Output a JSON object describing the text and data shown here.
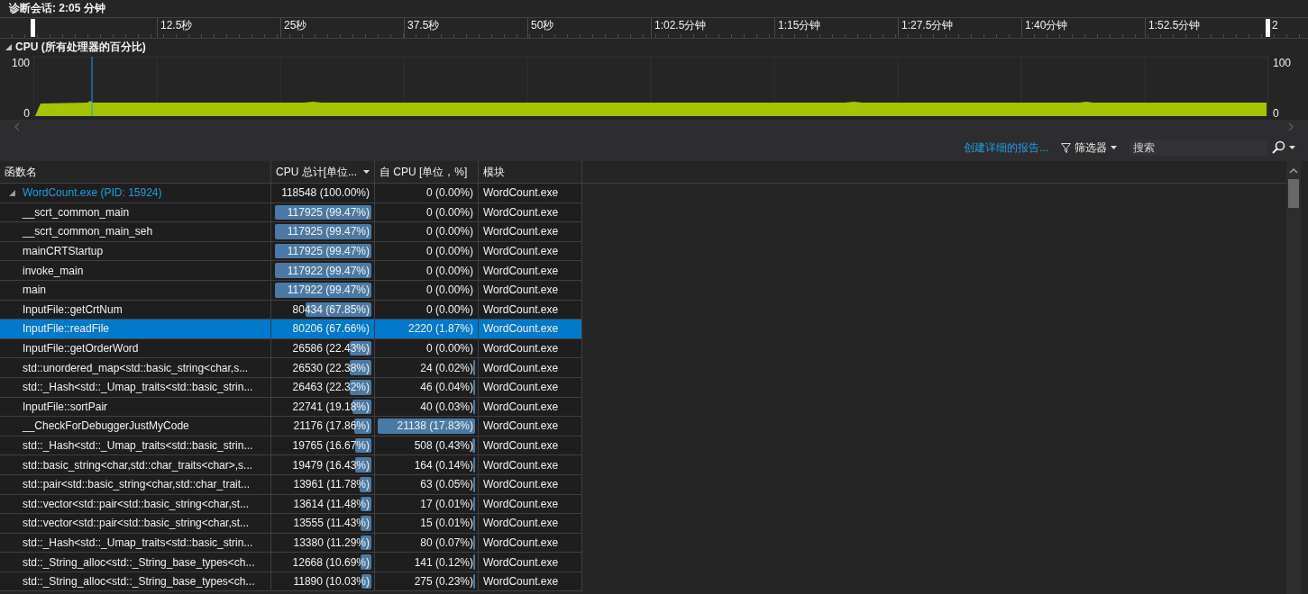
{
  "session": {
    "title": "诊断会话: 2:05 分钟"
  },
  "timeline": {
    "labels": [
      "12.5秒",
      "25秒",
      "37.5秒",
      "50秒",
      "1:02.5分钟",
      "1:15分钟",
      "1:27.5分钟",
      "1:40分钟",
      "1:52.5分钟",
      "2"
    ]
  },
  "cpu_panel": {
    "expanded": true,
    "title": "CPU (所有处理器的百分比)",
    "left_axis": [
      "100",
      "0"
    ],
    "right_axis": [
      "100",
      "0"
    ]
  },
  "toolbar": {
    "report_link": "创建详细的报告...",
    "filter": "筛选器",
    "search": {
      "placeholder": "搜索"
    }
  },
  "table": {
    "columns": [
      {
        "label": "函数名",
        "sorted": false
      },
      {
        "label": "CPU 总计[单位...",
        "sorted": true
      },
      {
        "label": "自 CPU [单位，%]",
        "sorted": false
      },
      {
        "label": "模块",
        "sorted": false
      }
    ],
    "rows": [
      {
        "name": "WordCount.exe (PID: 15924)",
        "expanded": true,
        "selected": false,
        "total": {
          "text": "118548 (100.00%)"
        },
        "self": {
          "text": "0 (0.00%)"
        },
        "module": "WordCount.exe",
        "children": [
          {
            "name": "__scrt_common_main",
            "selected": false,
            "total": {
              "text": "117925 (99.47%)",
              "level": 0.9947
            },
            "self": {
              "text": "0 (0.00%)"
            },
            "module": "WordCount.exe"
          },
          {
            "name": "__scrt_common_main_seh",
            "selected": false,
            "total": {
              "text": "117925 (99.47%)",
              "level": 0.9947
            },
            "self": {
              "text": "0 (0.00%)"
            },
            "module": "WordCount.exe"
          },
          {
            "name": "mainCRTStartup",
            "selected": false,
            "total": {
              "text": "117925 (99.47%)",
              "level": 0.9947
            },
            "self": {
              "text": "0 (0.00%)"
            },
            "module": "WordCount.exe"
          },
          {
            "name": "invoke_main",
            "selected": false,
            "total": {
              "text": "117922 (99.47%)",
              "level": 0.9947
            },
            "self": {
              "text": "0 (0.00%)"
            },
            "module": "WordCount.exe"
          },
          {
            "name": "main",
            "selected": false,
            "total": {
              "text": "117922 (99.47%)",
              "level": 0.9947
            },
            "self": {
              "text": "0 (0.00%)"
            },
            "module": "WordCount.exe"
          },
          {
            "name": "InputFile::getCrtNum",
            "selected": false,
            "total": {
              "text": "80434 (67.85%)",
              "level": 0.6785
            },
            "self": {
              "text": "0 (0.00%)"
            },
            "module": "WordCount.exe"
          },
          {
            "name": "InputFile::readFile",
            "selected": true,
            "total": {
              "text": "80206 (67.66%)"
            },
            "self": {
              "text": "2220 (1.87%)"
            },
            "module": "WordCount.exe"
          },
          {
            "name": "InputFile::getOrderWord",
            "selected": false,
            "total": {
              "text": "26586 (22.43%)",
              "level": 0.2243
            },
            "self": {
              "text": "0 (0.00%)"
            },
            "module": "WordCount.exe"
          },
          {
            "name": "std::unordered_map<std::basic_string<char,s...",
            "selected": false,
            "total": {
              "text": "26530 (22.38%)",
              "level": 0.2238
            },
            "self": {
              "text": "24 (0.02%)",
              "level": 0.0011
            },
            "module": "WordCount.exe"
          },
          {
            "name": "std::_Hash<std::_Umap_traits<std::basic_strin...",
            "selected": false,
            "total": {
              "text": "26463 (22.32%)",
              "level": 0.2232
            },
            "self": {
              "text": "46 (0.04%)",
              "level": 0.0022
            },
            "module": "WordCount.exe"
          },
          {
            "name": "InputFile::sortPair",
            "selected": false,
            "total": {
              "text": "22741 (19.18%)",
              "level": 0.1918
            },
            "self": {
              "text": "40 (0.03%)",
              "level": 0.0019
            },
            "module": "WordCount.exe"
          },
          {
            "name": "__CheckForDebuggerJustMyCode",
            "selected": false,
            "total": {
              "text": "21176 (17.86%)",
              "level": 0.1786
            },
            "self": {
              "text": "21138 (17.83%)",
              "level": 1
            },
            "module": "WordCount.exe"
          },
          {
            "name": "std::_Hash<std::_Umap_traits<std::basic_strin...",
            "selected": false,
            "total": {
              "text": "19765 (16.67%)",
              "level": 0.1667
            },
            "self": {
              "text": "508 (0.43%)",
              "level": 0.024
            },
            "module": "WordCount.exe"
          },
          {
            "name": "std::basic_string<char,std::char_traits<char>,s...",
            "selected": false,
            "total": {
              "text": "19479 (16.43%)",
              "level": 0.1643
            },
            "self": {
              "text": "164 (0.14%)",
              "level": 0.0078
            },
            "module": "WordCount.exe"
          },
          {
            "name": "std::pair<std::basic_string<char,std::char_trait...",
            "selected": false,
            "total": {
              "text": "13961 (11.78%)",
              "level": 0.1178
            },
            "self": {
              "text": "63 (0.05%)",
              "level": 0.003
            },
            "module": "WordCount.exe"
          },
          {
            "name": "std::vector<std::pair<std::basic_string<char,st...",
            "selected": false,
            "total": {
              "text": "13614 (11.48%)",
              "level": 0.1148
            },
            "self": {
              "text": "17 (0.01%)",
              "level": 0.0008
            },
            "module": "WordCount.exe"
          },
          {
            "name": "std::vector<std::pair<std::basic_string<char,st...",
            "selected": false,
            "total": {
              "text": "13555 (11.43%)",
              "level": 0.1143
            },
            "self": {
              "text": "15 (0.01%)",
              "level": 0.0007
            },
            "module": "WordCount.exe"
          },
          {
            "name": "std::_Hash<std::_Umap_traits<std::basic_strin...",
            "selected": false,
            "total": {
              "text": "13380 (11.29%)",
              "level": 0.1129
            },
            "self": {
              "text": "80 (0.07%)",
              "level": 0.0038
            },
            "module": "WordCount.exe"
          },
          {
            "name": "std::_String_alloc<std::_String_base_types<ch...",
            "selected": false,
            "total": {
              "text": "12668 (10.69%)",
              "level": 0.1069
            },
            "self": {
              "text": "141 (0.12%)",
              "level": 0.0067
            },
            "module": "WordCount.exe"
          },
          {
            "name": "std::_String_alloc<std::_String_base_types<ch...",
            "selected": false,
            "total": {
              "text": "11890 (10.03%)",
              "level": 0.1003
            },
            "self": {
              "text": "275 (0.23%)",
              "level": 0.013
            },
            "module": "WordCount.exe"
          }
        ]
      }
    ]
  }
}
